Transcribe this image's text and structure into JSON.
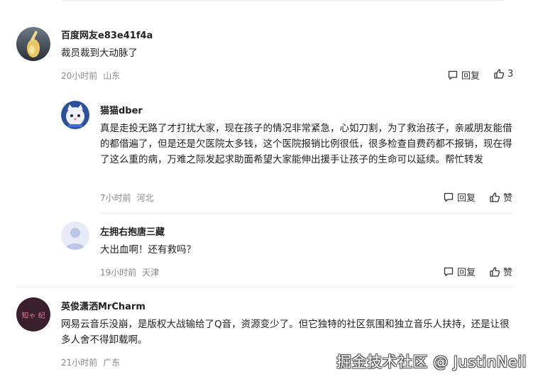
{
  "comments": [
    {
      "author": "百度网友e83e41f4a",
      "content": "裁员裁到大动脉了",
      "time": "20小时前",
      "location": "山东",
      "reply_label": "回复",
      "like_label": "3",
      "replies": [
        {
          "author": "猫猫dber",
          "content": "真是走投无路了才打扰大家，现在孩子的情况非常紧急，心如刀割，为了救治孩子，亲戚朋友能借的都借遍了，但是还是欠医院太多钱，这个医院报销比例很低，很多检查自费药都不报销，现在得了这么重的病，万难之际发起求助面希望大家能伸出援手让孩子的生命可以延续。帮忙转发",
          "time": "7小时前",
          "location": "河北",
          "reply_label": "回复",
          "like_label": "赞"
        },
        {
          "author": "左拥右抱唐三藏",
          "content": "大出血啊！还有救吗？",
          "time": "19小时前",
          "location": "天津",
          "reply_label": "回复",
          "like_label": "赞"
        }
      ]
    },
    {
      "author": "英俊潇洒MrCharm",
      "avatar_text": "知ゃ 纪",
      "content": "网易云音乐没崩，是版权大战输给了Q音，资源变少了。但它独特的社区氛围和独立音乐人扶持，还是让很多人舍不得卸载啊。",
      "time": "21小时前",
      "location": "广东"
    }
  ],
  "watermark": "掘金技术社区 @ JustinNeil",
  "icons": {
    "reply": "comment-icon",
    "like": "thumbs-up-icon"
  },
  "colors": {
    "meta": "#8a8a8a",
    "text": "#222222"
  }
}
